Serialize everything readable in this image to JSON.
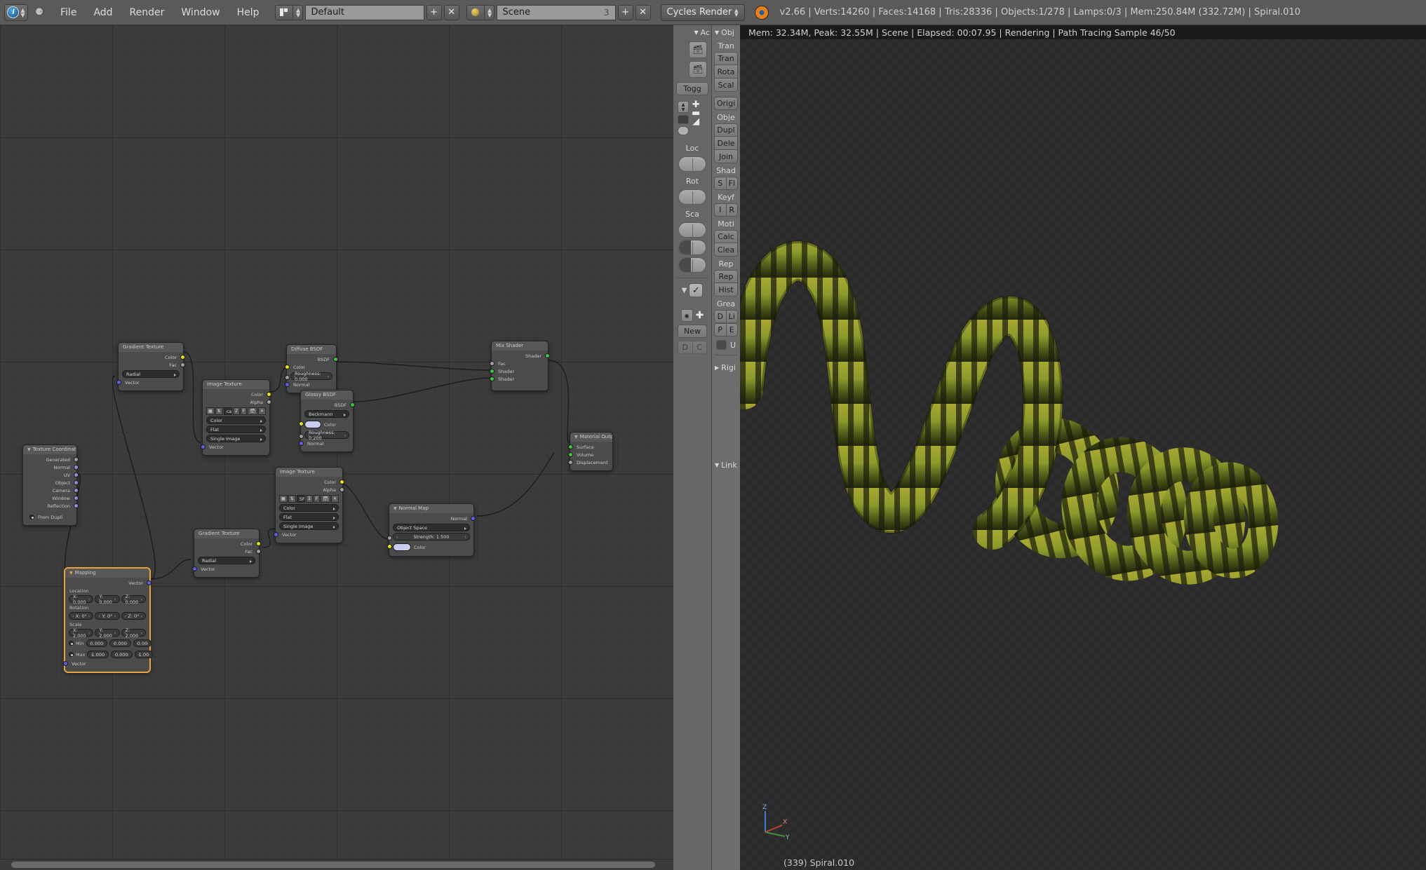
{
  "topbar": {
    "logo_icon": "blender-logo-icon",
    "collapse_icon": "collapse-icon",
    "menus": [
      "File",
      "Add",
      "Render",
      "Window",
      "Help"
    ],
    "screen_layout": {
      "value": "Default",
      "add_label": "+",
      "close_label": "✕"
    },
    "scene": {
      "value": "Scene",
      "count": "3",
      "add_label": "+",
      "close_label": "✕"
    },
    "engine": {
      "value": "Cycles Render"
    },
    "engine_icon": "cycles-icon",
    "stats": "v2.66 | Verts:14260 | Faces:14168 | Tris:28336 | Objects:1/278 | Lamps:0/3 | Mem:250.84M (332.72M) | Spiral.010"
  },
  "viewport": {
    "render_status": "Mem: 32.34M, Peak: 32.55M | Scene | Elapsed: 00:07.95 | Rendering | Path Tracing Sample 46/50",
    "footer": "(339) Spiral.010",
    "axis_labels": {
      "x": "X",
      "y": "Y",
      "z": "Z"
    },
    "cursor_name": "3d-cursor"
  },
  "toolpanel_left": {
    "title": "Ac",
    "title_full": "Active Tool",
    "buttons": [
      "Togg"
    ],
    "labels": [
      "Loc",
      "Rot",
      "Sca"
    ],
    "new_button": "New",
    "dc_button": [
      "D",
      "C"
    ]
  },
  "toolpanel_right": {
    "title": "Obj",
    "sections": [
      {
        "label": "Tran",
        "buttons": [
          "Tran",
          "Rota",
          "Scal"
        ]
      },
      {
        "label": "",
        "buttons": [
          "Origi"
        ]
      },
      {
        "label": "Obje",
        "buttons": [
          "Dupl",
          "Dele",
          "Join"
        ]
      },
      {
        "label": "Shad",
        "pair": [
          "S",
          "Fl"
        ]
      },
      {
        "label": "Keyf",
        "pair": [
          "I",
          "R"
        ]
      },
      {
        "label": "Moti",
        "buttons": [
          "Calc",
          "Clea"
        ]
      },
      {
        "label": "Rep",
        "buttons": [
          "Rep",
          "Hist"
        ]
      },
      {
        "label": "Grea",
        "pair2": [
          [
            "D",
            "Li"
          ],
          [
            "P",
            "E"
          ]
        ],
        "toggle_label": "U"
      }
    ],
    "rigid_label": "Rigi",
    "link_label": "Link"
  },
  "node_editor": {
    "nodes": [
      {
        "id": "gradient1",
        "title": "Gradient Texture",
        "outputs": [
          "Color",
          "Fac"
        ],
        "dropdown": "Radial",
        "inputs": [
          "Vector"
        ]
      },
      {
        "id": "imgtex1",
        "title": "Image Texture",
        "outputs": [
          "Color",
          "Alpha"
        ],
        "image_name": "cartoon.jpg",
        "image_users": "2",
        "image_fake": "F",
        "dropdowns": [
          "Color",
          "Flat",
          "Single Image"
        ],
        "inputs": [
          "Vector"
        ]
      },
      {
        "id": "diffuse",
        "title": "Diffuse BSDF",
        "outputs": [
          "BSDF"
        ],
        "inputs": [
          "Color"
        ],
        "value_label": "Roughness: 0.000",
        "inputs2": [
          "Normal"
        ]
      },
      {
        "id": "glossy",
        "title": "Glossy BSDF",
        "outputs": [
          "BSDF"
        ],
        "dropdown": "Beckmann",
        "color_label": "Color",
        "value_label": "Roughness: 0.200",
        "inputs2": [
          "Normal"
        ]
      },
      {
        "id": "mixshader",
        "title": "Mix Shader",
        "outputs": [
          "Shader"
        ],
        "inputs": [
          "Fac",
          "Shader",
          "Shader"
        ]
      },
      {
        "id": "matout",
        "title": "Material Output",
        "inputs": [
          "Surface",
          "Volume",
          "Displacement"
        ]
      },
      {
        "id": "texcoord",
        "title": "Texture Coordinate",
        "outputs": [
          "Generated",
          "Normal",
          "UV",
          "Object",
          "Camera",
          "Window",
          "Reflection"
        ],
        "checkbox_label": "From Dupli"
      },
      {
        "id": "imgtex2",
        "title": "Image Texture",
        "outputs": [
          "Color",
          "Alpha"
        ],
        "image_name": "SPEC.png",
        "image_users": "2",
        "image_fake": "F",
        "dropdowns": [
          "Color",
          "Flat",
          "Single Image"
        ],
        "inputs": [
          "Vector"
        ]
      },
      {
        "id": "gradient2",
        "title": "Gradient Texture",
        "outputs": [
          "Color",
          "Fac"
        ],
        "dropdown": "Radial",
        "inputs": [
          "Vector"
        ]
      },
      {
        "id": "normalmap",
        "title": "Normal Map",
        "outputs": [
          "Normal"
        ],
        "dropdown": "Object Space",
        "value_label": "Strength: 1.500",
        "color_label": "Color"
      },
      {
        "id": "mapping",
        "title": "Mapping",
        "selected": true,
        "outputs": [
          "Vector"
        ],
        "groups": [
          {
            "label": "Location",
            "values": [
              "X: 0.000",
              "Y: 0.000",
              "Z: 0.000"
            ]
          },
          {
            "label": "Rotation",
            "values": [
              "X: 0°",
              "Y: 0°",
              "Z: 0°"
            ]
          },
          {
            "label": "Scale",
            "values": [
              "X: 2.000",
              "Y: 2.000",
              "Z: 2.000"
            ]
          }
        ],
        "min_label": "Min",
        "min_values": [
          "0.000",
          "0.000",
          "0.00"
        ],
        "max_label": "Max",
        "max_values": [
          "1.000",
          "0.000",
          "1.00"
        ],
        "inputs": [
          "Vector"
        ]
      }
    ]
  },
  "colors": {
    "accent": "#e8a33d",
    "socket_color": "#e8e020",
    "socket_shader": "#3ec43e",
    "socket_vector": "#5d5de8",
    "socket_value": "#a0a0a0",
    "header_bg": "#5a5a5a",
    "node_bg": "#4b4b4b"
  }
}
